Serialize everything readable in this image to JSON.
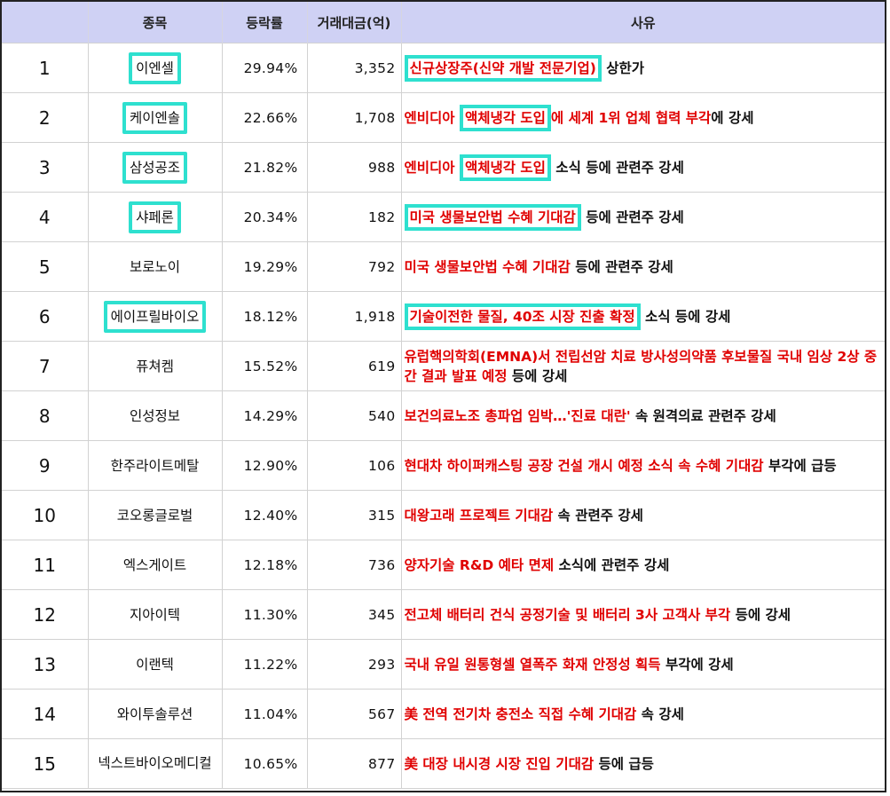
{
  "headers": {
    "rank": "",
    "stock": "종목",
    "rate": "등락률",
    "amount": "거래대금(억)",
    "reason": "사유"
  },
  "rows": [
    {
      "rank": "1",
      "stock": "이엔셀",
      "rate": "29.94%",
      "amount": "3,352",
      "reason_parts": [
        {
          "t": "신규상장주(신약 개발 전문기업)",
          "c": "red",
          "box": true
        },
        {
          "t": " 상한가",
          "c": "black"
        }
      ]
    },
    {
      "rank": "2",
      "stock": "케이엔솔",
      "rate": "22.66%",
      "amount": "1,708",
      "reason_parts": [
        {
          "t": "엔비디아 ",
          "c": "red"
        },
        {
          "t": "액체냉각 도입",
          "c": "red",
          "box": true
        },
        {
          "t": "에 세계 1위 업체 협력 부각",
          "c": "red"
        },
        {
          "t": "에 강세",
          "c": "black"
        }
      ]
    },
    {
      "rank": "3",
      "stock": "삼성공조",
      "rate": "21.82%",
      "amount": "988",
      "reason_parts": [
        {
          "t": "엔비디아 ",
          "c": "red"
        },
        {
          "t": "액체냉각 도입",
          "c": "red",
          "box": true
        },
        {
          "t": " 소식 등에 관련주 강세",
          "c": "black"
        }
      ]
    },
    {
      "rank": "4",
      "stock": "샤페론",
      "rate": "20.34%",
      "amount": "182",
      "reason_parts": [
        {
          "t": "미국 생물보안법 수혜 기대감",
          "c": "red",
          "box": true
        },
        {
          "t": " 등에 관련주 강세",
          "c": "black"
        }
      ]
    },
    {
      "rank": "5",
      "stock": "보로노이",
      "rate": "19.29%",
      "amount": "792",
      "reason_parts": [
        {
          "t": "미국 생물보안법 수혜 기대감",
          "c": "red"
        },
        {
          "t": " 등에 관련주 강세",
          "c": "black"
        }
      ]
    },
    {
      "rank": "6",
      "stock": "에이프릴바이오",
      "rate": "18.12%",
      "amount": "1,918",
      "reason_parts": [
        {
          "t": "기술이전한 물질, 40조 시장 진출 확정",
          "c": "red",
          "box": true
        },
        {
          "t": " 소식 등에 강세",
          "c": "black"
        }
      ]
    },
    {
      "rank": "7",
      "stock": "퓨쳐켐",
      "rate": "15.52%",
      "amount": "619",
      "reason_parts": [
        {
          "t": "유럽핵의학회(EMNA)서 전립선암 치료 방사성의약품 후보물질 국내 임상 2상 중간 결과 발표 예정",
          "c": "red"
        },
        {
          "t": " 등에 강세",
          "c": "black"
        }
      ]
    },
    {
      "rank": "8",
      "stock": "인성정보",
      "rate": "14.29%",
      "amount": "540",
      "reason_parts": [
        {
          "t": "보건의료노조 총파업 임박…'진료 대란'",
          "c": "red"
        },
        {
          "t": " 속 원격의료 관련주 강세",
          "c": "black"
        }
      ]
    },
    {
      "rank": "9",
      "stock": "한주라이트메탈",
      "rate": "12.90%",
      "amount": "106",
      "reason_parts": [
        {
          "t": "현대차 하이퍼캐스팅 공장 건설 개시 예정 소식 속 수혜 기대감",
          "c": "red"
        },
        {
          "t": " 부각에 급등",
          "c": "black"
        }
      ]
    },
    {
      "rank": "10",
      "stock": "코오롱글로벌",
      "rate": "12.40%",
      "amount": "315",
      "reason_parts": [
        {
          "t": "대왕고래 프로젝트 기대감",
          "c": "red"
        },
        {
          "t": " 속 관련주 강세",
          "c": "black"
        }
      ]
    },
    {
      "rank": "11",
      "stock": "엑스게이트",
      "rate": "12.18%",
      "amount": "736",
      "reason_parts": [
        {
          "t": "양자기술 R&D 예타 면제",
          "c": "red"
        },
        {
          "t": " 소식에 관련주 강세",
          "c": "black"
        }
      ]
    },
    {
      "rank": "12",
      "stock": "지아이텍",
      "rate": "11.30%",
      "amount": "345",
      "reason_parts": [
        {
          "t": "전고체 배터리 건식 공정기술 및 배터리 3사 고객사 부각",
          "c": "red"
        },
        {
          "t": " 등에 강세",
          "c": "black"
        }
      ]
    },
    {
      "rank": "13",
      "stock": "이랜텍",
      "rate": "11.22%",
      "amount": "293",
      "reason_parts": [
        {
          "t": "국내 유일 원통형셀 열폭주 화재 안정성 획득",
          "c": "red"
        },
        {
          "t": " 부각에 강세",
          "c": "black"
        }
      ]
    },
    {
      "rank": "14",
      "stock": "와이투솔루션",
      "rate": "11.04%",
      "amount": "567",
      "reason_parts": [
        {
          "t": "美 전역 전기차 충전소 직접 수혜 기대감",
          "c": "red"
        },
        {
          "t": " 속 강세",
          "c": "black"
        }
      ]
    },
    {
      "rank": "15",
      "stock": "넥스트바이오메디컬",
      "rate": "10.65%",
      "amount": "877",
      "reason_parts": [
        {
          "t": "美 대장 내시경 시장 진입 기대감",
          "c": "red"
        },
        {
          "t": " 등에 급등",
          "c": "black"
        }
      ]
    }
  ],
  "highlighted_stocks": [
    "1",
    "2",
    "3",
    "4",
    "6"
  ],
  "colors": {
    "header_bg": "#cfd1f4",
    "highlight_border": "#2ee0cf",
    "reason_red": "#e00000"
  }
}
